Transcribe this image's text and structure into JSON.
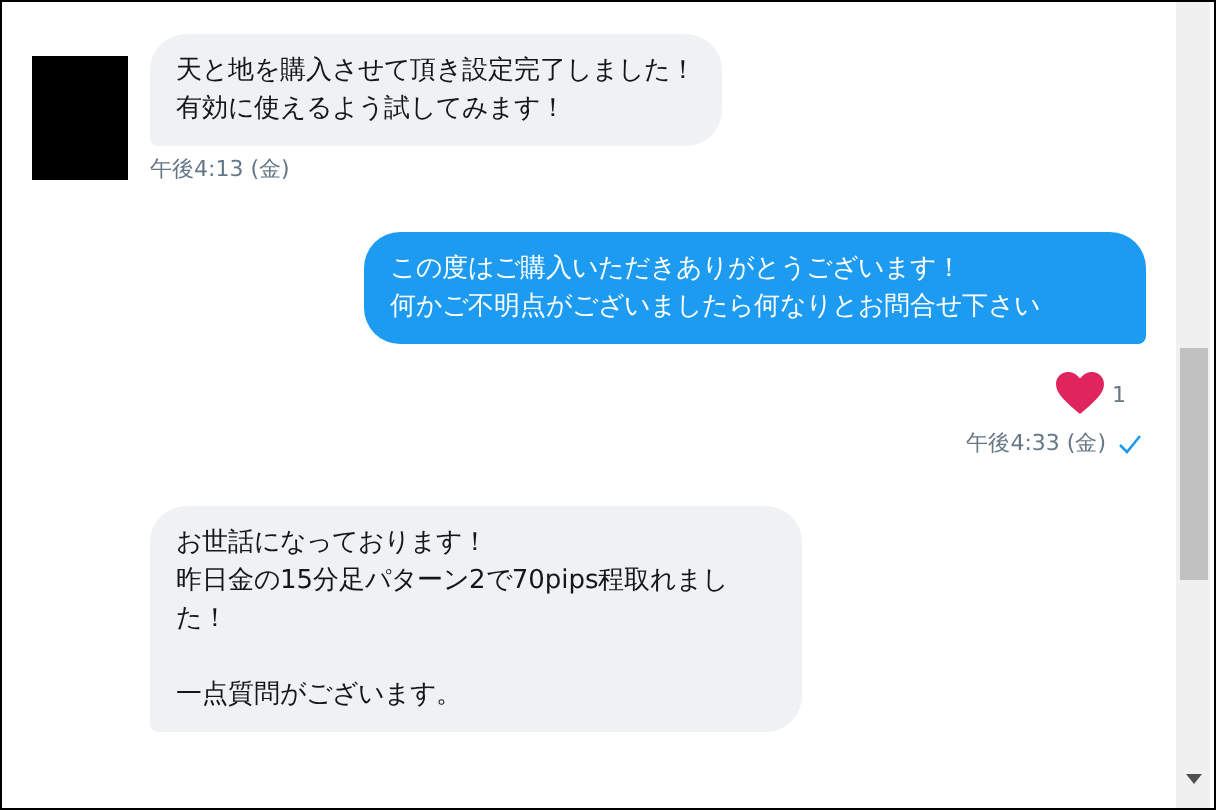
{
  "messages": [
    {
      "kind": "received",
      "lines": [
        "天と地を購入させて頂き設定完了しました！",
        "有効に使えるよう試してみます！"
      ],
      "time": "午後4:13 (金)"
    },
    {
      "kind": "sent",
      "lines": [
        "この度はご購入いただきありがとうございます！",
        "何かご不明点がございましたら何なりとお問合せ下さい"
      ],
      "likes": "1",
      "time": "午後4:33 (金)",
      "read": true
    },
    {
      "kind": "received",
      "lines": [
        "お世話になっております！",
        "昨日金の15分足パターン2で70pips程取れました！",
        "一点質問がございます。"
      ]
    }
  ]
}
